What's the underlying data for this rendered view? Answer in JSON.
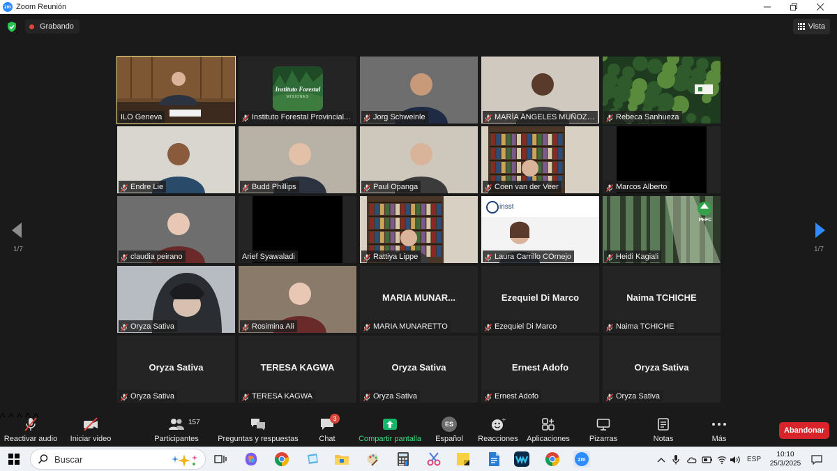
{
  "window": {
    "title": "Zoom Reunión",
    "logo_text": "zm"
  },
  "topbar": {
    "recording_label": "Grabando",
    "view_label": "Vista"
  },
  "pagination": {
    "left_page": "1/7",
    "right_page": "1/7"
  },
  "participants": [
    {
      "name": "ILO Geneva",
      "big_name": "",
      "video": "ilo"
    },
    {
      "name": "Instituto Forestal Provincial...",
      "big_name": "",
      "video": "logo-forestal"
    },
    {
      "name": "Jorg Schweinle",
      "big_name": "",
      "video": "person"
    },
    {
      "name": "MARÍA ÁNGELES MUÑOZ ...",
      "big_name": "",
      "video": "person"
    },
    {
      "name": "Rebeca Sanhueza",
      "big_name": "",
      "video": "forest"
    },
    {
      "name": "Endre Lie",
      "big_name": "",
      "video": "person"
    },
    {
      "name": "Budd Phillips",
      "big_name": "",
      "video": "person"
    },
    {
      "name": "Paul Opanga",
      "big_name": "",
      "video": "person"
    },
    {
      "name": "Coen van der Veer",
      "big_name": "",
      "video": "bookshelf"
    },
    {
      "name": "Marcos Alberto",
      "big_name": "",
      "video": "black"
    },
    {
      "name": "claudia peirano",
      "big_name": "",
      "video": "person"
    },
    {
      "name": "Arief Syawaladi",
      "big_name": "",
      "video": "black"
    },
    {
      "name": "Rattiya Lippe",
      "big_name": "",
      "video": "bookshelf"
    },
    {
      "name": "Laura Carrillo COrnejo",
      "big_name": "",
      "video": "insst"
    },
    {
      "name": "Heidi Kagiali",
      "big_name": "",
      "video": "pefc"
    },
    {
      "name": "Oryza Sativa",
      "big_name": "",
      "video": "hooded"
    },
    {
      "name": "Rosimina Ali",
      "big_name": "",
      "video": "person"
    },
    {
      "name": "MARIA MUNARETTO",
      "big_name": "MARIA  MUNAR...",
      "video": "none"
    },
    {
      "name": "Ezequiel Di Marco",
      "big_name": "Ezequiel Di Marco",
      "video": "none"
    },
    {
      "name": "Naima TCHICHE",
      "big_name": "Naima TCHICHE",
      "video": "none"
    },
    {
      "name": "Oryza Sativa",
      "big_name": "Oryza Sativa",
      "video": "none"
    },
    {
      "name": "TERESA KAGWA",
      "big_name": "TERESA KAGWA",
      "video": "none"
    },
    {
      "name": "Oryza Sativa",
      "big_name": "Oryza Sativa",
      "video": "none"
    },
    {
      "name": "Ernest Adofo",
      "big_name": "Ernest Adofo",
      "video": "none"
    },
    {
      "name": "Oryza Sativa",
      "big_name": "Oryza Sativa",
      "video": "none"
    }
  ],
  "tile_texts": {
    "forestal_logo_line1": "Instituto Forestal",
    "forestal_logo_line2": "MISIONES",
    "insst_logo": "insst",
    "pefc_logo": "PEFC"
  },
  "toolbar": {
    "audio_label": "Reactivar audio",
    "video_label": "Iniciar video",
    "participants_label": "Participantes",
    "participants_count": "157",
    "qa_label": "Preguntas y respuestas",
    "chat_label": "Chat",
    "chat_badge": "3",
    "share_label": "Compartir pantalla",
    "language_label": "Español",
    "language_code": "ES",
    "reactions_label": "Reacciones",
    "apps_label": "Aplicaciones",
    "whiteboards_label": "Pizarras",
    "notes_label": "Notas",
    "more_label": "Más",
    "leave_label": "Abandonar"
  },
  "taskbar": {
    "search_placeholder": "Buscar",
    "language_indicator": "ESP",
    "time": "10:10",
    "date": "25/3/2025",
    "zoom_app_text": "zm"
  },
  "colors": {
    "zoom_blue": "#2d8cff",
    "leave_red": "#d7232a",
    "share_green": "#12b76a",
    "active_speaker": "#f0e68c"
  }
}
